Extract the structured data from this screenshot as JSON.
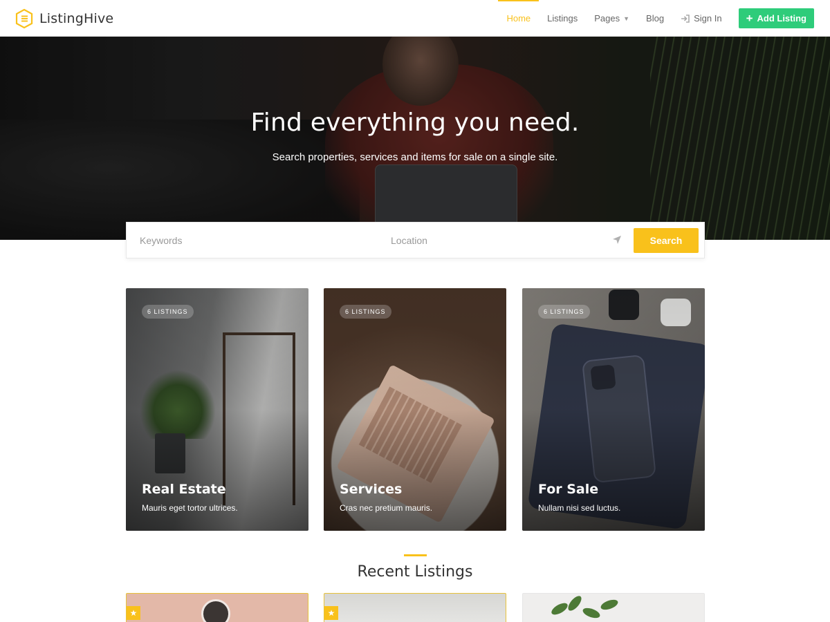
{
  "brand": {
    "name": "ListingHive",
    "accent": "#f9c11b",
    "success": "#2ecc7a"
  },
  "nav": {
    "items": [
      {
        "label": "Home",
        "active": true
      },
      {
        "label": "Listings"
      },
      {
        "label": "Pages",
        "dropdown": true
      },
      {
        "label": "Blog"
      },
      {
        "label": "Sign In",
        "icon": "sign-in-icon"
      }
    ],
    "add_listing": "Add Listing"
  },
  "hero": {
    "title": "Find everything you need.",
    "subtitle": "Search properties, services and items for sale on a single site."
  },
  "search": {
    "keywords_placeholder": "Keywords",
    "location_placeholder": "Location",
    "button": "Search",
    "location_icon": "location-arrow-icon"
  },
  "categories": [
    {
      "count": "6 LISTINGS",
      "title": "Real Estate",
      "desc": "Mauris eget tortor ultrices."
    },
    {
      "count": "6 LISTINGS",
      "title": "Services",
      "desc": "Cras nec pretium mauris."
    },
    {
      "count": "6 LISTINGS",
      "title": "For Sale",
      "desc": "Nullam nisi sed luctus."
    }
  ],
  "recent": {
    "title": "Recent Listings"
  }
}
